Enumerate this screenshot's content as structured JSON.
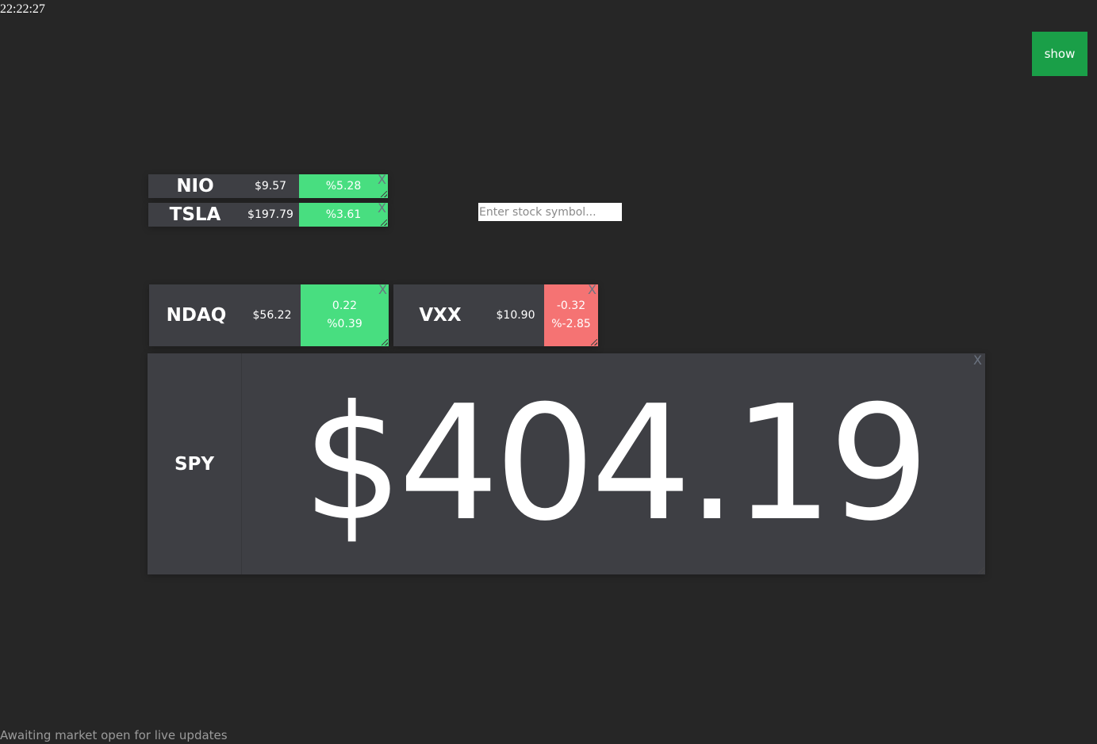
{
  "clock": "22:22:27",
  "toolbar": {
    "show_label": "show"
  },
  "search": {
    "placeholder": "Enter stock symbol..."
  },
  "tiles": {
    "nio": {
      "symbol": "NIO",
      "price": "$9.57",
      "pct": "%5.28",
      "close": "X"
    },
    "tsla": {
      "symbol": "TSLA",
      "price": "$197.79",
      "pct": "%3.61",
      "close": "X"
    },
    "ndaq": {
      "symbol": "NDAQ",
      "price": "$56.22",
      "change": "0.22",
      "pct": "%0.39",
      "close": "X"
    },
    "vxx": {
      "symbol": "VXX",
      "price": "$10.90",
      "change": "-0.32",
      "pct": "%-2.85",
      "close": "X"
    },
    "spy": {
      "symbol": "SPY",
      "price": "$404.19",
      "close": "X"
    }
  },
  "colors": {
    "up": "#48de80",
    "down": "#f57373",
    "show_button": "#1a9f48",
    "tile": "#3e3f44",
    "background": "#262626"
  },
  "status": "Awaiting market open for live updates"
}
